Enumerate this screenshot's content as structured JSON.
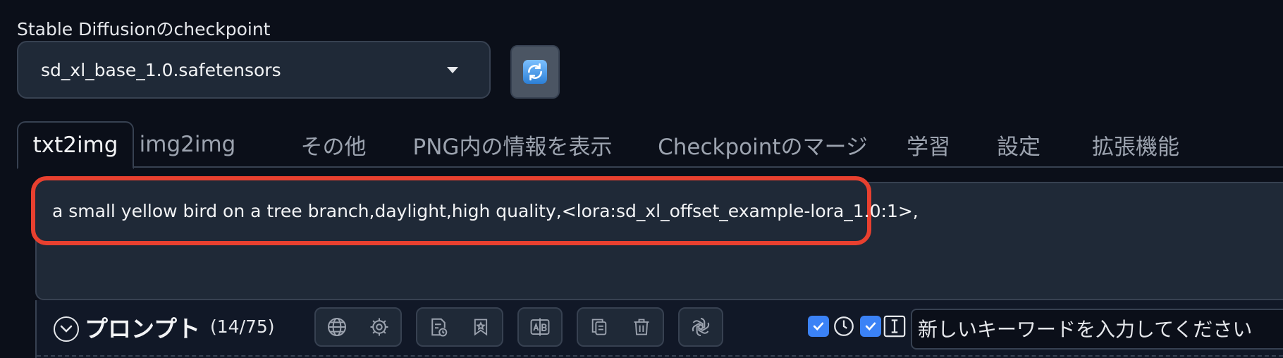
{
  "checkpoint": {
    "label": "Stable Diffusionのcheckpoint",
    "selected": "sd_xl_base_1.0.safetensors"
  },
  "tabs": [
    {
      "label": "txt2img",
      "active": true
    },
    {
      "label": "img2img"
    },
    {
      "label": "その他"
    },
    {
      "label": "PNG内の情報を表示"
    },
    {
      "label": "Checkpointのマージ"
    },
    {
      "label": "学習"
    },
    {
      "label": "設定"
    },
    {
      "label": "拡張機能"
    }
  ],
  "prompt": {
    "text": "a small yellow bird on a tree branch,daylight,high quality,<lora:sd_xl_offset_example-lora_1.0:1>,"
  },
  "toolbar": {
    "title": "プロンプト",
    "token_count": "(14/75)",
    "keyword_placeholder": "新しいキーワードを入力してください"
  },
  "colors": {
    "accent_highlight": "#e8402f",
    "checkbox": "#3b82f6",
    "background": "#0b0f19"
  }
}
